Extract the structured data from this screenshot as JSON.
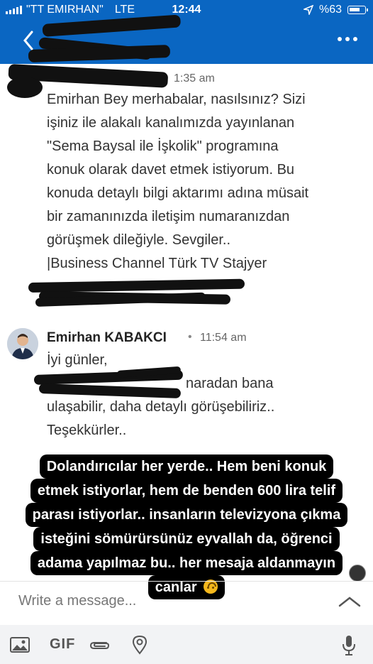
{
  "status_bar": {
    "carrier": "\"TT EMIRHAN\"",
    "network": "LTE",
    "time": "12:44",
    "battery": "%63"
  },
  "header": {
    "back_icon": "chevron-left-icon",
    "more_icon": "more-dots-icon"
  },
  "messages": [
    {
      "timestamp": "1:35 am",
      "lines": [
        "Emirhan Bey merhabalar, nasılsınız? Sizi",
        "işiniz ile alakalı kanalımızda yayınlanan",
        "\"Sema Baysal ile İşkolik\" programına",
        "konuk olarak davet etmek istiyorum. Bu",
        "konuda detaylı bilgi aktarımı adına müsait",
        "bir zamanınızda iletişim numaranızdan",
        "görüşmek dileğiyle. Sevgiler..",
        "|Business Channel Türk TV Stajyer"
      ]
    },
    {
      "sender": "Emirhan KABAKCI",
      "separator": "•",
      "timestamp": "11:54 am",
      "lines": [
        "İyi günler,",
        "naradan bana",
        "ulaşabilir, daha detaylı görüşebiliriz..",
        "Teşekkürler.."
      ]
    }
  ],
  "caption": {
    "lines": [
      "Dolandırıcılar her yerde.. Hem beni konuk",
      "etmek istiyorlar, hem de benden 600 lira telif",
      "parası istiyorlar.. insanların televizyona çıkma",
      "isteğini sömürürsünüz eyvallah da, öğrenci",
      "adama yapılmaz bu.. her mesaja aldanmayın",
      "canlar"
    ],
    "emoji": "upside-down-smile-icon"
  },
  "composer": {
    "placeholder": "Write a message..."
  },
  "toolbar": {
    "gif_label": "GIF",
    "icons": [
      "image-icon",
      "gif-icon",
      "attachment-icon",
      "location-icon",
      "microphone-icon"
    ]
  },
  "colors": {
    "header_bg": "#0a66c2",
    "caption_bg": "#000000",
    "toolbar_bg": "#f2f3f5"
  }
}
